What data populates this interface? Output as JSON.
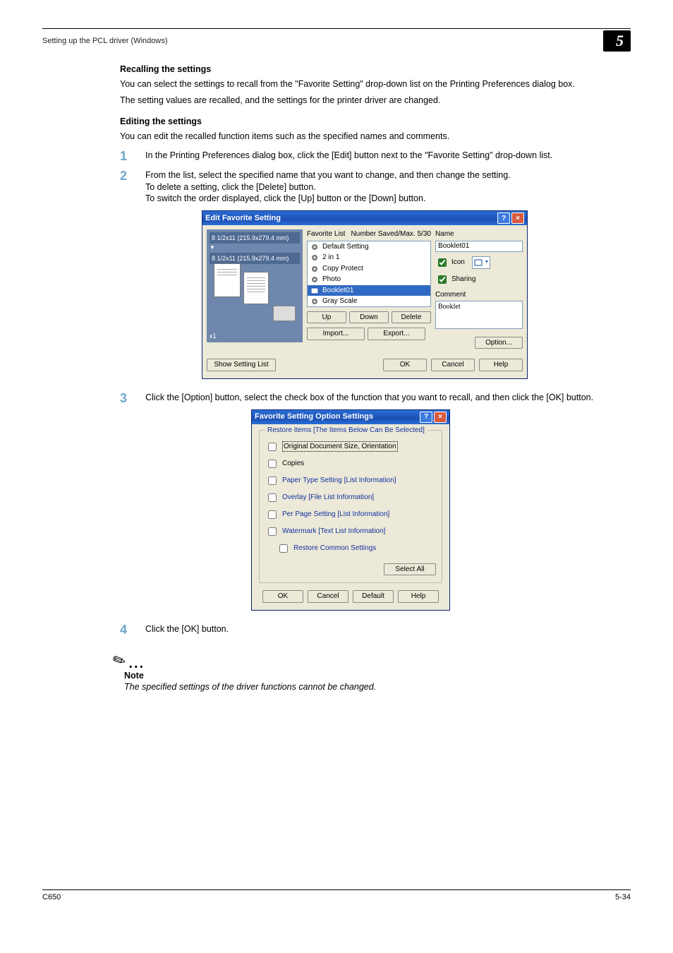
{
  "header": {
    "section": "Setting up the PCL driver (Windows)",
    "chapter": "5"
  },
  "section1": {
    "heading": "Recalling the settings",
    "p1": "You can select the settings to recall from the \"Favorite Setting\" drop-down list on the Printing Preferences dialog box.",
    "p2": "The setting values are recalled, and the settings for the printer driver are changed."
  },
  "section2": {
    "heading": "Editing the settings",
    "intro": "You can edit the recalled function items such as the specified names and comments.",
    "step1": "In the Printing Preferences dialog box, click the [Edit] button next to the \"Favorite Setting\" drop-down list.",
    "step2a": "From the list, select the specified name that you want to change, and then change the setting.",
    "step2b": "To delete a setting, click the [Delete] button.",
    "step2c": "To switch the order displayed, click the [Up] button or the [Down] button.",
    "step3": "Click the [Option] button, select the check box of the function that you want to recall, and then click the [OK] button.",
    "step4": "Click the [OK] button."
  },
  "efs": {
    "title": "Edit Favorite Setting",
    "preview_size": "8 1/2x11 (215.9x279.4 mm)",
    "preview_size2": "8 1/2x11 (215.9x279.4 mm)",
    "x1": "x1",
    "list_label": "Favorite List",
    "count_label": "Number Saved/Max. 5/30",
    "items": [
      {
        "label": "Default Setting"
      },
      {
        "label": "2 in 1"
      },
      {
        "label": "Copy Protect"
      },
      {
        "label": "Photo"
      },
      {
        "label": "Booklet01",
        "selected": true
      },
      {
        "label": "Gray Scale"
      }
    ],
    "btn_up": "Up",
    "btn_down": "Down",
    "btn_delete": "Delete",
    "btn_import": "Import...",
    "btn_export": "Export...",
    "name_label": "Name",
    "name_value": "Booklet01",
    "icon_label": "Icon",
    "sharing_label": "Sharing",
    "comment_label": "Comment",
    "comment_value": "Booklet",
    "btn_option": "Option...",
    "btn_showlist": "Show Setting List",
    "btn_ok": "OK",
    "btn_cancel": "Cancel",
    "btn_help": "Help"
  },
  "fsos": {
    "title": "Favorite Setting Option Settings",
    "legend": "Restore Items [The Items Below Can Be Selected]",
    "items": [
      {
        "label": "Original Document Size, Orientation",
        "focus": true
      },
      {
        "label": "Copies"
      },
      {
        "label": "Paper Type Setting [List Information]",
        "blue": true
      },
      {
        "label": "Overlay [File List Information]",
        "blue": true
      },
      {
        "label": "Per Page Setting [List Information]",
        "blue": true
      },
      {
        "label": "Watermark [Text List Information]",
        "blue": true
      },
      {
        "label": "Restore Common Settings",
        "blue": true,
        "indent": true
      }
    ],
    "btn_selectall": "Select All",
    "btn_ok": "OK",
    "btn_cancel": "Cancel",
    "btn_default": "Default",
    "btn_help": "Help"
  },
  "note": {
    "label": "Note",
    "text": "The specified settings of the driver functions cannot be changed."
  },
  "footer": {
    "model": "C650",
    "page": "5-34"
  }
}
